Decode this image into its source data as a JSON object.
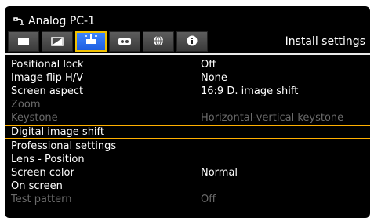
{
  "header": {
    "source_icon": "input-plug-icon",
    "source_label": "Analog PC-1",
    "section_title": "Install settings"
  },
  "tabs": [
    {
      "icon": "image-adjust-icon",
      "active": false
    },
    {
      "icon": "picture-contrast-icon",
      "active": false
    },
    {
      "icon": "projector-install-icon",
      "active": true
    },
    {
      "icon": "system-settings-icon",
      "active": false
    },
    {
      "icon": "network-globe-icon",
      "active": false
    },
    {
      "icon": "info-icon",
      "active": false
    }
  ],
  "menu": [
    {
      "label": "Positional lock",
      "value": "Off",
      "state": "normal"
    },
    {
      "label": "Image flip H/V",
      "value": "None",
      "state": "normal"
    },
    {
      "label": "Screen aspect",
      "value": "16:9 D. image shift",
      "state": "normal"
    },
    {
      "label": "Zoom",
      "value": "",
      "state": "disabled"
    },
    {
      "label": "Keystone",
      "value": "Horizontal-vertical keystone",
      "state": "disabled"
    },
    {
      "label": "Digital image shift",
      "value": "",
      "state": "selected"
    },
    {
      "label": "Professional settings",
      "value": "",
      "state": "normal"
    },
    {
      "label": "Lens - Position",
      "value": "",
      "state": "normal"
    },
    {
      "label": "Screen color",
      "value": "Normal",
      "state": "normal"
    },
    {
      "label": "On screen",
      "value": "",
      "state": "normal"
    },
    {
      "label": "Test pattern",
      "value": "Off",
      "state": "disabled"
    }
  ],
  "colors": {
    "selection_border": "#ffb000",
    "active_tab": "#2a6cf0",
    "disabled_text": "#6b6b6b"
  }
}
